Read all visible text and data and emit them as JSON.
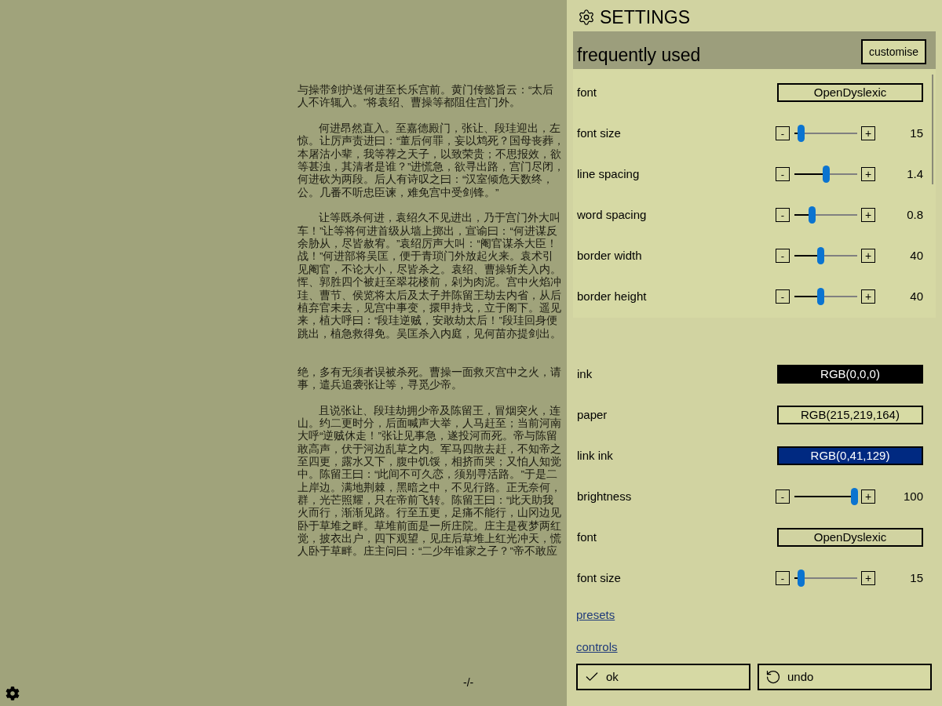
{
  "reader": {
    "paragraphs": [
      {
        "indent": false,
        "lines": [
          "与操带剑护送何进至长乐宫前。黄门传懿旨云：“太后",
          "人不许辄入。”将袁绍、曹操等都阻住宫门外。"
        ]
      },
      {
        "indent": true,
        "lines": [
          "何进昂然直入。至嘉德殿门，张让、段珪迎出，左",
          "惊。让厉声责进曰：“董后何罪，妄以鸩死？国母丧葬，",
          "本屠沽小辈，我等荐之天子，以致荣贵；不思报效，欲",
          "等甚浊，其清者是谁？”进慌急，欲寻出路，宫门尽闭，",
          "何进砍为两段。后人有诗叹之曰：“汉室倾危天数终，",
          "公。几番不听忠臣谏，难免宫中受剑锋。”"
        ]
      },
      {
        "indent": true,
        "lines": [
          "让等既杀何进，袁绍久不见进出，乃于宫门外大叫",
          "车！”让等将何进首级从墙上掷出，宣谕曰：“何进谋反",
          "余胁从，尽皆赦宥。”袁绍厉声大叫：“阉官谋杀大臣！",
          "战！”何进部将吴匡，便于青琐门外放起火来。袁术引",
          "见阉官，不论大小，尽皆杀之。袁绍、曹操斩关入内。",
          "恽、郭胜四个被赶至翠花楼前，剁为肉泥。宫中火焰冲",
          "珪、曹节、侯览将太后及太子并陈留王劫去内省，从后",
          "植弃官未去，见宫中事变，擐甲持戈，立于阁下。遥见",
          "来，植大呼曰：“段珪逆贼，安敢劫太后！”段珪回身便",
          "跳出，植急救得免。吴匡杀入内庭，见何苗亦提剑出。"
        ]
      },
      {
        "indent": false,
        "lines": [
          "绝，多有无须者误被杀死。曹操一面救灭宫中之火，请",
          "事，遣兵追袭张让等，寻觅少帝。"
        ]
      },
      {
        "indent": true,
        "lines": [
          "且说张让、段珪劫拥少帝及陈留王，冒烟突火，连",
          "山。约二更时分，后面喊声大举，人马赶至；当前河南",
          "大呼“逆贼休走！”张让见事急，遂投河而死。帝与陈留",
          "敢高声，伏于河边乱草之内。军马四散去赶，不知帝之",
          "至四更，露水又下，腹中饥馁，相挤而哭；又怕人知觉",
          "中。陈留王曰：“此间不可久恋，须别寻活路。”于是二",
          "上岸边。满地荆棘，黑暗之中，不见行路。正无奈何，",
          "群，光芒照耀，只在帝前飞转。陈留王曰：“此天助我",
          "火而行，渐渐见路。行至五更，足痛不能行，山冈边见",
          "卧于草堆之畔。草堆前面是一所庄院。庄主是夜梦两红",
          "觉，披衣出户，四下观望，见庄后草堆上红光冲天，慌",
          "人卧于草畔。庄主问曰：“二少年谁家之子？”帝不敢应"
        ]
      }
    ],
    "page_indicator": "-/-"
  },
  "settings": {
    "title": "SETTINGS",
    "frequently_used": {
      "title": "frequently used",
      "button": "customise",
      "rows": [
        {
          "kind": "select",
          "label": "font",
          "value": "OpenDyslexic"
        },
        {
          "kind": "slider",
          "label": "font size",
          "minus": "-",
          "plus": "+",
          "level": 0.1,
          "reading": "15"
        },
        {
          "kind": "slider",
          "label": "line spacing",
          "minus": "-",
          "plus": "+",
          "level": 0.5,
          "reading": "1.4"
        },
        {
          "kind": "slider",
          "label": "word spacing",
          "minus": "-",
          "plus": "+",
          "level": 0.27,
          "reading": "0.8"
        },
        {
          "kind": "slider",
          "label": "border width",
          "minus": "-",
          "plus": "+",
          "level": 0.41,
          "reading": "40"
        },
        {
          "kind": "slider",
          "label": "border height",
          "minus": "-",
          "plus": "+",
          "level": 0.41,
          "reading": "40"
        }
      ]
    },
    "rows": [
      {
        "kind": "color",
        "label": "ink",
        "value": "RGB(0,0,0)",
        "color": "#000000"
      },
      {
        "kind": "color",
        "label": "paper",
        "value": "RGB(215,219,164)",
        "color": "#d7dba4"
      },
      {
        "kind": "color",
        "label": "link ink",
        "value": "RGB(0,41,129)",
        "color": "#002981"
      },
      {
        "kind": "slider",
        "label": "brightness",
        "minus": "-",
        "plus": "+",
        "level": 0.95,
        "reading": "100"
      },
      {
        "kind": "select",
        "label": "font",
        "value": "OpenDyslexic"
      },
      {
        "kind": "slider",
        "label": "font size",
        "minus": "-",
        "plus": "+",
        "level": 0.1,
        "reading": "15"
      }
    ],
    "links": [
      "presets",
      "controls"
    ],
    "buttons": [
      {
        "kind": "ok",
        "label": "ok"
      },
      {
        "kind": "undo",
        "label": "undo"
      }
    ]
  }
}
